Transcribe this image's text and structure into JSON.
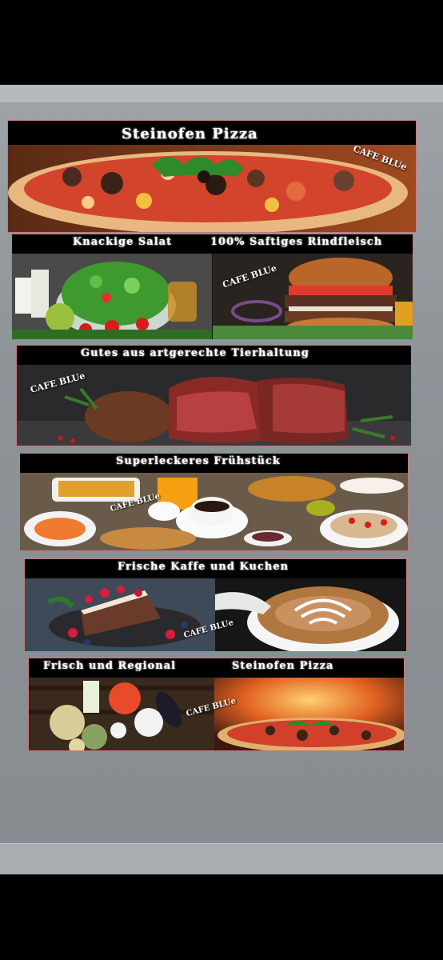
{
  "badge": "CAFE BLUe",
  "panels": {
    "pizza_top": {
      "title": "Steinofen Pizza"
    },
    "salat": {
      "title": "Knackige Salat"
    },
    "rind": {
      "title": "100% Saftiges Rindfleisch"
    },
    "tier": {
      "title": "Gutes aus artgerechte Tierhaltung"
    },
    "fruh": {
      "title": "Superleckeres Frühstück"
    },
    "kaffe": {
      "title": "Frische  Kaffe und Kuchen"
    },
    "regional": {
      "title": "Frisch und Regional"
    },
    "pizza_bottom": {
      "title": "Steinofen Pizza"
    }
  }
}
